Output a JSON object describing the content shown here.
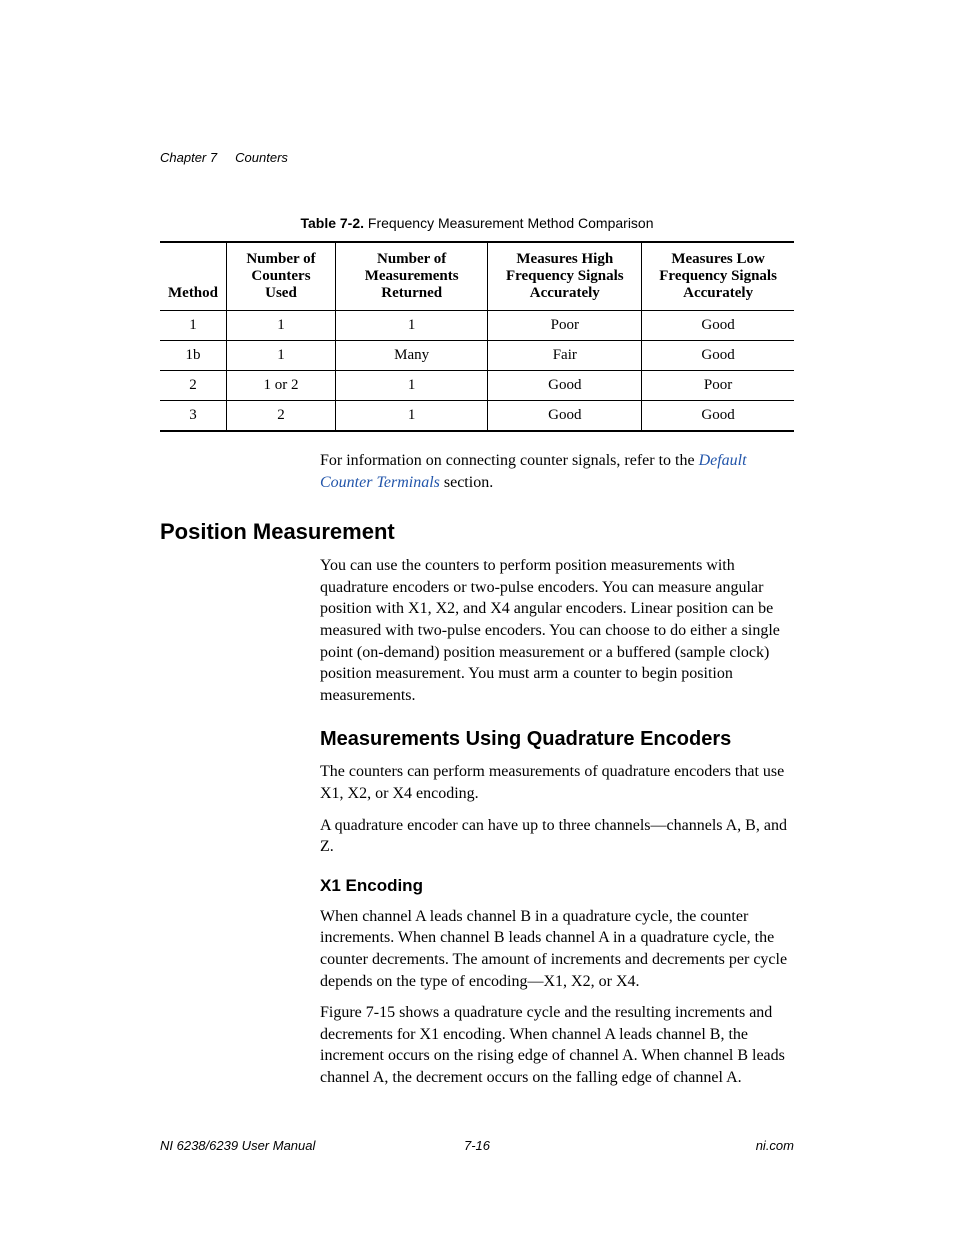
{
  "header": {
    "chapter_label": "Chapter 7",
    "chapter_title": "Counters"
  },
  "table": {
    "caption_label": "Table 7-2.",
    "caption_text": "Frequency Measurement Method Comparison",
    "headers": [
      "Method",
      "Number of Counters Used",
      "Number of Measurements Returned",
      "Measures High Frequency Signals Accurately",
      "Measures Low Frequency Signals Accurately"
    ],
    "rows": [
      [
        "1",
        "1",
        "1",
        "Poor",
        "Good"
      ],
      [
        "1b",
        "1",
        "Many",
        "Fair",
        "Good"
      ],
      [
        "2",
        "1 or 2",
        "1",
        "Good",
        "Poor"
      ],
      [
        "3",
        "2",
        "1",
        "Good",
        "Good"
      ]
    ]
  },
  "xref_para": {
    "pre": "For information on connecting counter signals, refer to the ",
    "link": "Default Counter Terminals",
    "post": " section."
  },
  "section1": {
    "heading": "Position Measurement",
    "para": "You can use the counters to perform position measurements with quadrature encoders or two-pulse encoders. You can measure angular position with X1, X2, and X4 angular encoders. Linear position can be measured with two-pulse encoders. You can choose to do either a single point (on-demand) position measurement or a buffered (sample clock) position measurement. You must arm a counter to begin position measurements."
  },
  "section2": {
    "heading": "Measurements Using Quadrature Encoders",
    "para1": "The counters can perform measurements of quadrature encoders that use X1, X2, or X4 encoding.",
    "para2": "A quadrature encoder can have up to three channels—channels A, B, and Z."
  },
  "section3": {
    "heading": "X1 Encoding",
    "para1": "When channel A leads channel B in a quadrature cycle, the counter increments. When channel B leads channel A in a quadrature cycle, the counter decrements. The amount of increments and decrements per cycle depends on the type of encoding—X1, X2, or X4.",
    "para2": "Figure 7-15 shows a quadrature cycle and the resulting increments and decrements for X1 encoding. When channel A leads channel B, the increment occurs on the rising edge of channel A. When channel B leads channel A, the decrement occurs on the falling edge of channel A."
  },
  "footer": {
    "left": "NI 6238/6239 User Manual",
    "center": "7-16",
    "right": "ni.com"
  }
}
